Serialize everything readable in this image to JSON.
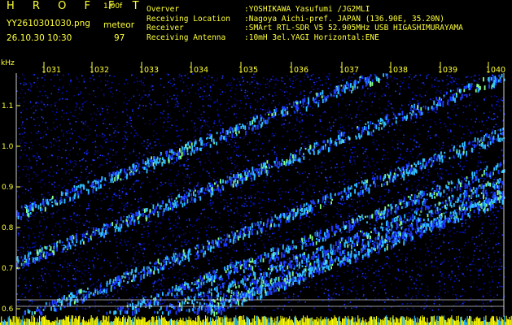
{
  "header": {
    "brand": "H R O F F T",
    "version": "1.00f",
    "filename": "YY2610301030.png",
    "mode": "meteor",
    "datetime": "26.10.30 10:30",
    "count": "97"
  },
  "station": [
    {
      "label": "Overver",
      "value": ":YOSHIKAWA Yasufumi /JG2MLI"
    },
    {
      "label": "Receiving Location",
      "value": ":Nagoya Aichi-pref. JAPAN (136.90E, 35.20N)"
    },
    {
      "label": "Receiver",
      "value": ":SMArt RTL-SDR V5 52.905MHz USB HIGASHIMURAYAMA"
    },
    {
      "label": "Receiving Antenna",
      "value": ":10mH 3el.YAGI Horizontal:ENE"
    }
  ],
  "axis": {
    "unit": "kHz",
    "y_ticks": [
      "1.1",
      "1.0",
      "0.9",
      "0.8",
      "0.7",
      "0.6"
    ],
    "x_ticks": [
      "1031",
      "1032",
      "1033",
      "1034",
      "1035",
      "1036",
      "1037",
      "1038",
      "1039",
      "1040"
    ]
  },
  "colors": {
    "text": "#ffff3a",
    "background": "#000000",
    "noise_dark": "#0a0a6e",
    "noise_mid": "#1e3cff",
    "signal": "#30c0ff",
    "peak": "#8aff8a",
    "baseline": "#ffff00"
  }
}
